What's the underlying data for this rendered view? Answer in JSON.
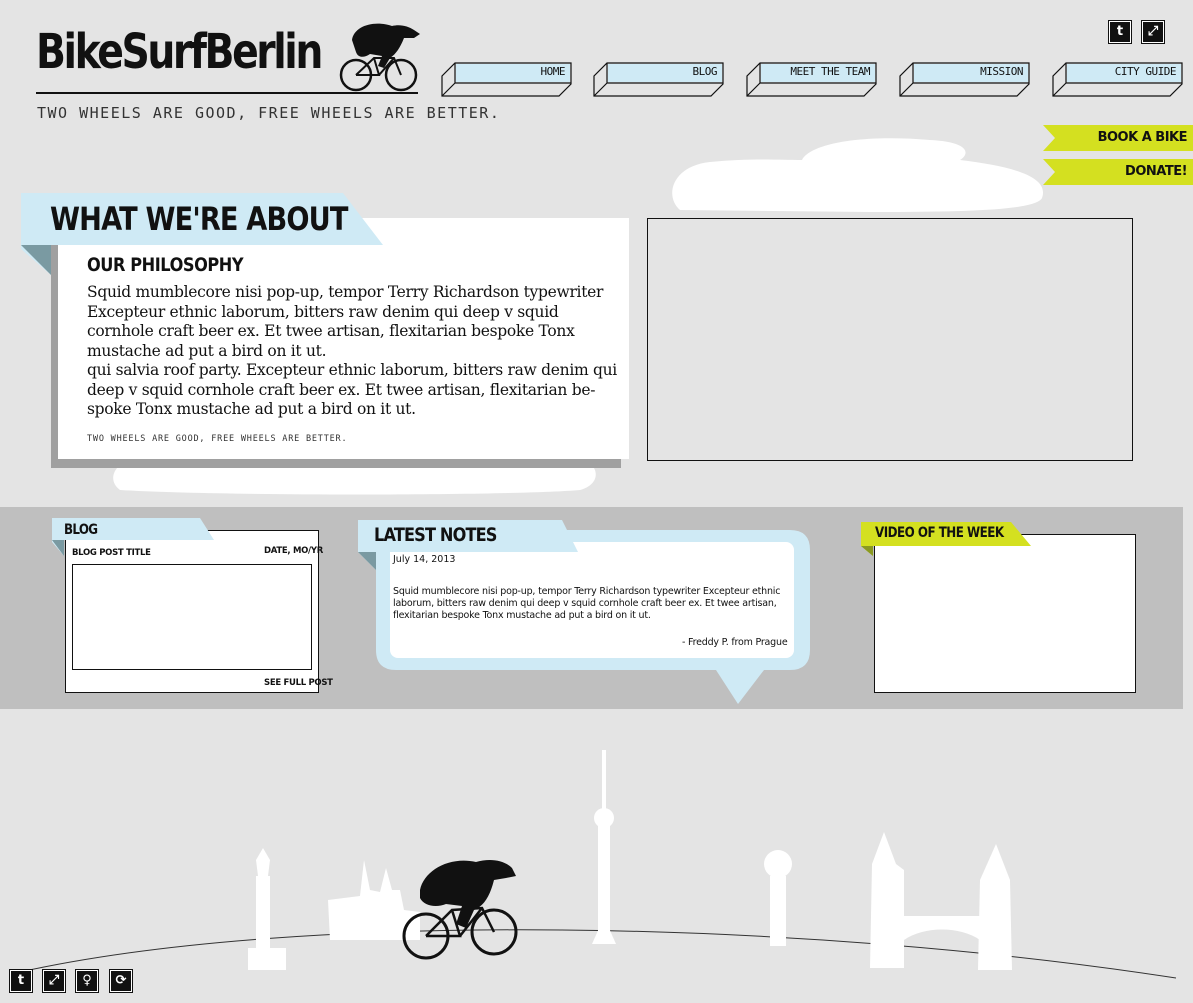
{
  "header": {
    "logo": "BikeSurfBerlin",
    "tagline": "Two wheels are good, free wheels are better."
  },
  "nav": [
    {
      "label": "HOME"
    },
    {
      "label": "BLOG"
    },
    {
      "label": "MEET THE TEAM"
    },
    {
      "label": "MISSION"
    },
    {
      "label": "CITY GUIDE"
    }
  ],
  "top_icons": [
    "twitter-icon",
    "link-icon"
  ],
  "actions": {
    "book": "BOOK A BIKE",
    "donate": "DONATE!"
  },
  "about": {
    "title": "WHAT WE'RE ABOUT",
    "subtitle": "OUR PHILOSOPHY",
    "paragraph1": "Squid mumblecore nisi pop-up, tempor Terry Richardson typewriter Excepteur ethnic laborum, bitters raw denim qui deep v squid cornhole craft beer ex. Et twee artisan, flexitarian bespoke Tonx mustache ad put a bird on it ut.",
    "paragraph2": "qui salvia roof party. Excepteur ethnic laborum, bitters raw denim qui deep v squid cornhole craft beer ex. Et twee artisan, flexitarian be-spoke Tonx mustache ad put a bird on it ut.",
    "tagline": "Two wheels are good, free wheels are better."
  },
  "blog": {
    "heading": "BLOG",
    "post_title": "BLOG POST TITLE",
    "date": "DATE, MO/YR",
    "link": "SEE FULL POST"
  },
  "notes": {
    "heading": "LATEST NOTES",
    "date": "July 14, 2013",
    "body": "Squid mumblecore nisi pop-up, tempor Terry Richardson typewriter Excepteur ethnic laborum, bitters raw denim qui deep v squid cornhole craft beer ex. Et twee artisan, flexitarian bespoke Tonx mustache ad put a bird on it ut.",
    "author": "- Freddy P. from Prague"
  },
  "video": {
    "heading": "VIDEO OF THE WEEK"
  },
  "footer_icons": [
    "twitter-icon",
    "link-icon",
    "user-icon",
    "refresh-icon"
  ],
  "colors": {
    "page": "#e4e4e4",
    "band": "#bfbfbf",
    "light_blue": "#cfeaf5",
    "lime": "#d4e020",
    "ink": "#111111"
  }
}
